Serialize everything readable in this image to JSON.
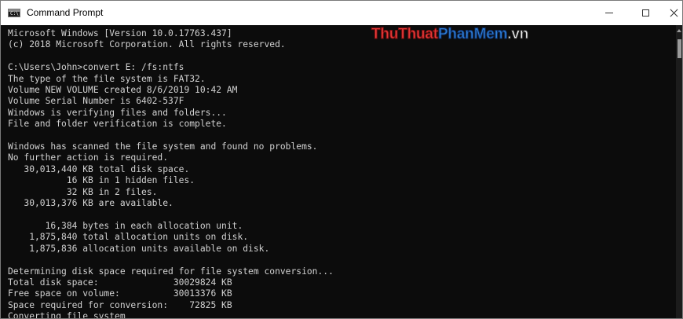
{
  "window": {
    "title": "Command Prompt",
    "icon": "cmd-icon",
    "icon_text": "C:\\"
  },
  "controls": {
    "minimize_icon": "minimize-icon",
    "maximize_icon": "maximize-icon",
    "close_icon": "close-icon"
  },
  "watermark": {
    "part1": "Thu",
    "part2": "Thuat",
    "part3": "PhanMem",
    "part4": ".vn"
  },
  "console": {
    "background": "#0c0c0c",
    "foreground": "#d2d2d2",
    "lines": [
      "Microsoft Windows [Version 10.0.17763.437]",
      "(c) 2018 Microsoft Corporation. All rights reserved.",
      "",
      "C:\\Users\\John>convert E: /fs:ntfs",
      "The type of the file system is FAT32.",
      "Volume NEW VOLUME created 8/6/2019 10:42 AM",
      "Volume Serial Number is 6402-537F",
      "Windows is verifying files and folders...",
      "File and folder verification is complete.",
      "",
      "Windows has scanned the file system and found no problems.",
      "No further action is required.",
      "   30,013,440 KB total disk space.",
      "           16 KB in 1 hidden files.",
      "           32 KB in 2 files.",
      "   30,013,376 KB are available.",
      "",
      "       16,384 bytes in each allocation unit.",
      "    1,875,840 total allocation units on disk.",
      "    1,875,836 allocation units available on disk.",
      "",
      "Determining disk space required for file system conversion...",
      "Total disk space:              30029824 KB",
      "Free space on volume:          30013376 KB",
      "Space required for conversion:    72825 KB",
      "Converting file system"
    ]
  }
}
